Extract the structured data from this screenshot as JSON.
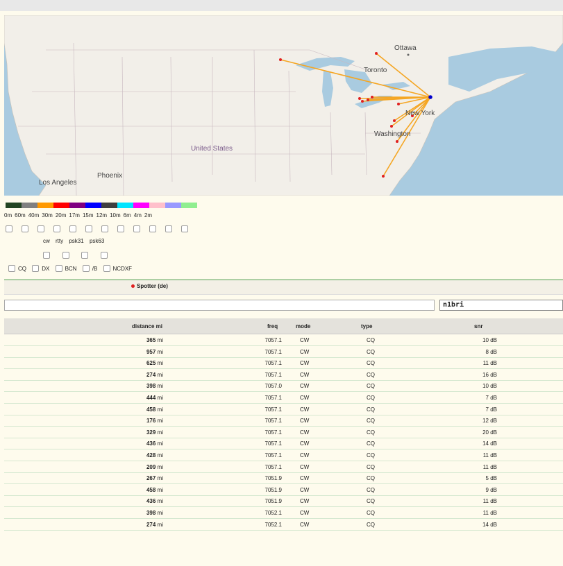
{
  "map": {
    "labels": [
      "Ottawa",
      "Toronto",
      "New York",
      "Washington",
      "United States",
      "Phoenix",
      "Los Angeles"
    ],
    "colors": {
      "land": "#f2efe9",
      "water": "#a9cbe0",
      "spot_line": "#f5a623",
      "spotter_dot": "#0000cc",
      "spot_dot": "#e02020"
    }
  },
  "bands": {
    "swatch_colors": [
      "#224422",
      "#808080",
      "#ff9900",
      "#ff0000",
      "#800080",
      "#0000ff",
      "#404040",
      "#00e5ff",
      "#ff00ff",
      "#ffc0cb",
      "#9999ff",
      "#90ee90"
    ],
    "labels": [
      "0m",
      "60m",
      "40m",
      "30m",
      "20m",
      "17m",
      "15m",
      "12m",
      "10m",
      "6m",
      "4m",
      "2m"
    ]
  },
  "modes": {
    "labels": [
      "cw",
      "rtty",
      "psk31",
      "psk63"
    ]
  },
  "types": {
    "labels": [
      "CQ",
      "DX",
      "BCN",
      "/B",
      "NCDXF"
    ]
  },
  "legend": {
    "spotter": "Spotter (de)"
  },
  "filter": {
    "callsign": "n1bri"
  },
  "table": {
    "headers": {
      "distance": "distance mi",
      "freq": "freq",
      "mode": "mode",
      "type": "type",
      "snr": "snr"
    },
    "unit_mi": "mi",
    "rows": [
      {
        "dist": "365",
        "freq": "7057.1",
        "mode": "CW",
        "type": "CQ",
        "snr": "10 dB"
      },
      {
        "dist": "957",
        "freq": "7057.1",
        "mode": "CW",
        "type": "CQ",
        "snr": "8 dB"
      },
      {
        "dist": "625",
        "freq": "7057.1",
        "mode": "CW",
        "type": "CQ",
        "snr": "11 dB"
      },
      {
        "dist": "274",
        "freq": "7057.1",
        "mode": "CW",
        "type": "CQ",
        "snr": "16 dB"
      },
      {
        "dist": "398",
        "freq": "7057.0",
        "mode": "CW",
        "type": "CQ",
        "snr": "10 dB"
      },
      {
        "dist": "444",
        "freq": "7057.1",
        "mode": "CW",
        "type": "CQ",
        "snr": "7 dB"
      },
      {
        "dist": "458",
        "freq": "7057.1",
        "mode": "CW",
        "type": "CQ",
        "snr": "7 dB"
      },
      {
        "dist": "176",
        "freq": "7057.1",
        "mode": "CW",
        "type": "CQ",
        "snr": "12 dB"
      },
      {
        "dist": "329",
        "freq": "7057.1",
        "mode": "CW",
        "type": "CQ",
        "snr": "20 dB"
      },
      {
        "dist": "436",
        "freq": "7057.1",
        "mode": "CW",
        "type": "CQ",
        "snr": "14 dB"
      },
      {
        "dist": "428",
        "freq": "7057.1",
        "mode": "CW",
        "type": "CQ",
        "snr": "11 dB"
      },
      {
        "dist": "209",
        "freq": "7057.1",
        "mode": "CW",
        "type": "CQ",
        "snr": "11 dB"
      },
      {
        "dist": "267",
        "freq": "7051.9",
        "mode": "CW",
        "type": "CQ",
        "snr": "5 dB"
      },
      {
        "dist": "458",
        "freq": "7051.9",
        "mode": "CW",
        "type": "CQ",
        "snr": "9 dB"
      },
      {
        "dist": "436",
        "freq": "7051.9",
        "mode": "CW",
        "type": "CQ",
        "snr": "11 dB"
      },
      {
        "dist": "398",
        "freq": "7052.1",
        "mode": "CW",
        "type": "CQ",
        "snr": "11 dB"
      },
      {
        "dist": "274",
        "freq": "7052.1",
        "mode": "CW",
        "type": "CQ",
        "snr": "14 dB"
      }
    ]
  }
}
